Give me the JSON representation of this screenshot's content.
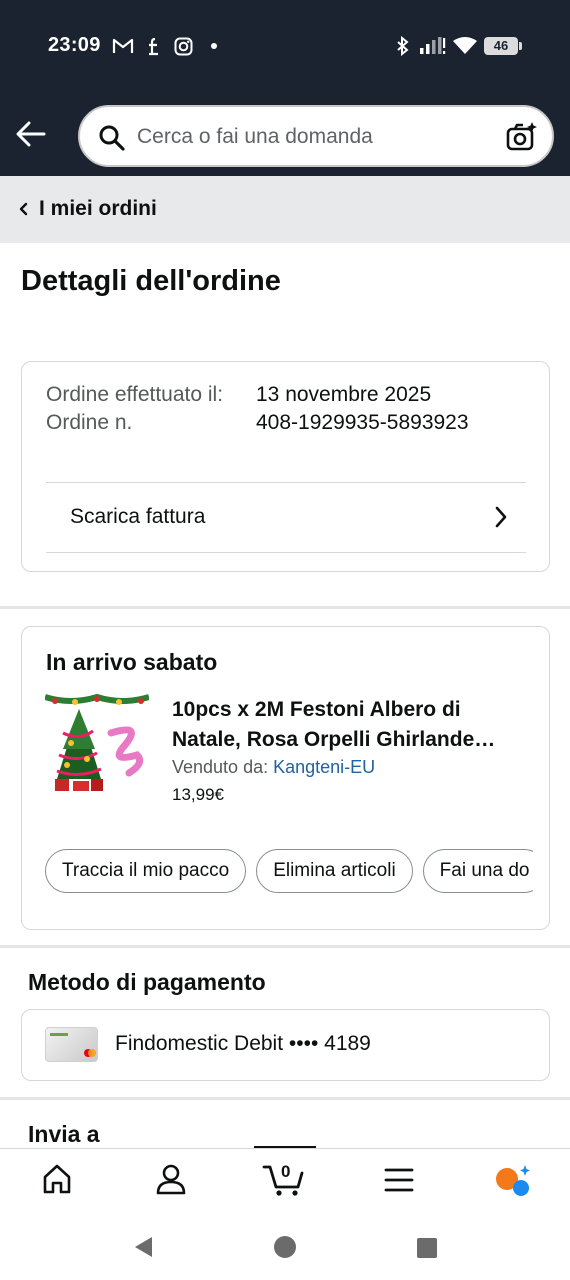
{
  "status_bar": {
    "time": "23:09",
    "notification_icons": [
      "gmail-icon",
      "facebook-icon",
      "instagram-icon",
      "dot-icon"
    ],
    "system_icons": [
      "bluetooth-icon",
      "signal-icon",
      "wifi-icon",
      "battery-icon"
    ],
    "battery": "46"
  },
  "header": {
    "search_placeholder": "Cerca o fai una domanda"
  },
  "breadcrumb": {
    "label": "I miei ordini"
  },
  "page_title": "Dettagli dell'ordine",
  "order_info": {
    "label": "Ordine effettuato il:\nOrdine n.",
    "date": "13 novembre 2025",
    "number": "408-1929935-5893923",
    "invoice_label": "Scarica fattura"
  },
  "shipment": {
    "heading": "In arrivo sabato",
    "product_title": "10pcs x 2M Festoni Albero di Natale, Rosa Orpelli Ghirlande…",
    "seller_prefix": "Venduto da: ",
    "seller_name": "Kangteni-EU",
    "price": "13,99€",
    "actions": [
      "Traccia il mio pacco",
      "Elimina articoli",
      "Fai una do"
    ]
  },
  "payment": {
    "heading": "Metodo di pagamento",
    "method": "Findomestic Debit •••• 4189"
  },
  "ship_to": {
    "heading": "Invia a"
  },
  "bottom_nav": {
    "items": [
      "home-icon",
      "account-icon",
      "cart-icon",
      "menu-icon",
      "rufus-icon"
    ],
    "cart_count": "0"
  },
  "colors": {
    "header_bg": "#1b2331",
    "link": "#2162a1",
    "rufus_orange": "#f3791a",
    "rufus_blue": "#1a8cf0"
  }
}
